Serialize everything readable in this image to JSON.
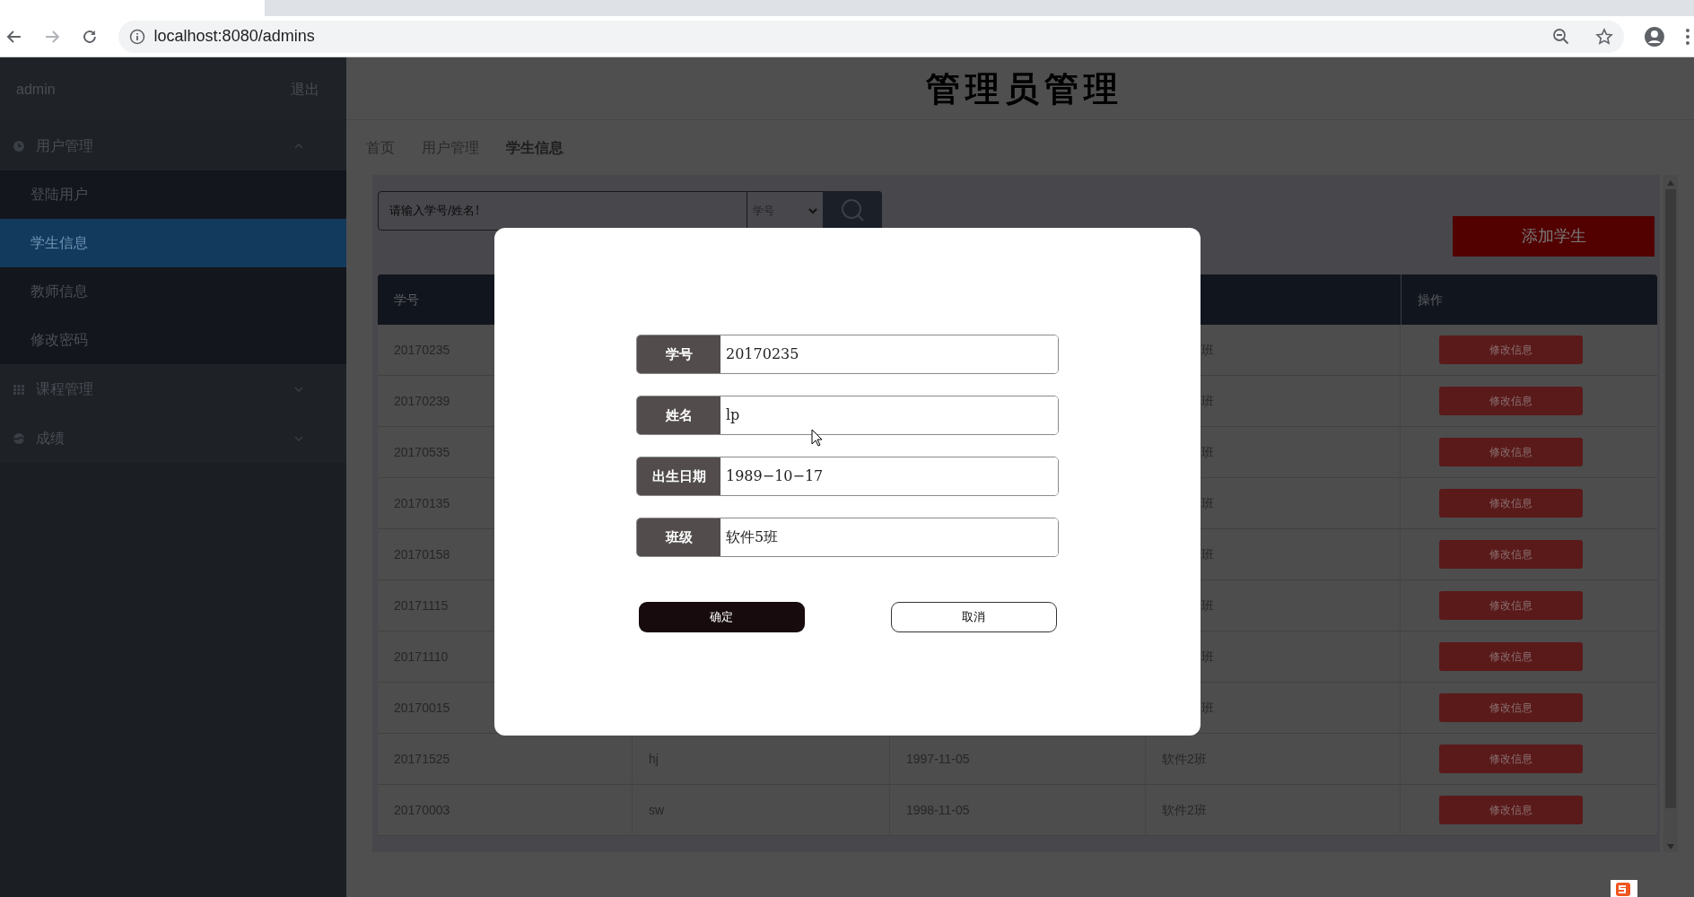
{
  "browser": {
    "url": "localhost:8080/admins"
  },
  "sidebar": {
    "user": "admin",
    "logout": "退出",
    "menus": [
      {
        "label": "用户管理",
        "expanded": true,
        "children": [
          {
            "label": "登陆用户",
            "selected": false
          },
          {
            "label": "学生信息",
            "selected": true
          },
          {
            "label": "教师信息",
            "selected": false
          },
          {
            "label": "修改密码",
            "selected": false
          }
        ]
      },
      {
        "label": "课程管理",
        "expanded": false
      },
      {
        "label": "成绩",
        "expanded": false
      }
    ]
  },
  "page_title": "管理员管理",
  "breadcrumb": [
    {
      "label": "首页",
      "current": false
    },
    {
      "label": "用户管理",
      "current": false
    },
    {
      "label": "学生信息",
      "current": true
    }
  ],
  "search": {
    "placeholder": "请输入学号/姓名!",
    "filter": "学号"
  },
  "add_button": "添加学生",
  "table": {
    "columns": [
      "学号",
      "操作"
    ],
    "rows": [
      {
        "cells": [
          "20170235",
          "班"
        ],
        "action": "修改信息"
      },
      {
        "cells": [
          "20170239",
          "班"
        ],
        "action": "修改信息"
      },
      {
        "cells": [
          "20170535",
          "班"
        ],
        "action": "修改信息"
      },
      {
        "cells": [
          "20170135",
          "班"
        ],
        "action": "修改信息"
      },
      {
        "cells": [
          "20170158",
          "班"
        ],
        "action": "修改信息"
      },
      {
        "cells": [
          "20171115",
          "班"
        ],
        "action": "修改信息"
      },
      {
        "cells": [
          "20171110",
          "班"
        ],
        "action": "修改信息"
      },
      {
        "cells": [
          "20170015",
          "班"
        ],
        "action": "修改信息"
      },
      {
        "cells": [
          "20171525",
          "hj",
          "1997-11-05",
          "软件2班"
        ],
        "action": "修改信息"
      },
      {
        "cells": [
          "20170003",
          "sw",
          "1998-11-05",
          "软件2班"
        ],
        "action": "修改信息"
      }
    ]
  },
  "dialog": {
    "fields": [
      {
        "label": "学号",
        "value": "20170235"
      },
      {
        "label": "姓名",
        "value": "lp"
      },
      {
        "label": "出生日期",
        "value": "1989−10−17"
      },
      {
        "label": "班级",
        "value": "软件5班"
      }
    ],
    "buttons": [
      {
        "label": "确定",
        "kind": "primary"
      },
      {
        "label": "取消",
        "kind": "secondary"
      }
    ]
  }
}
